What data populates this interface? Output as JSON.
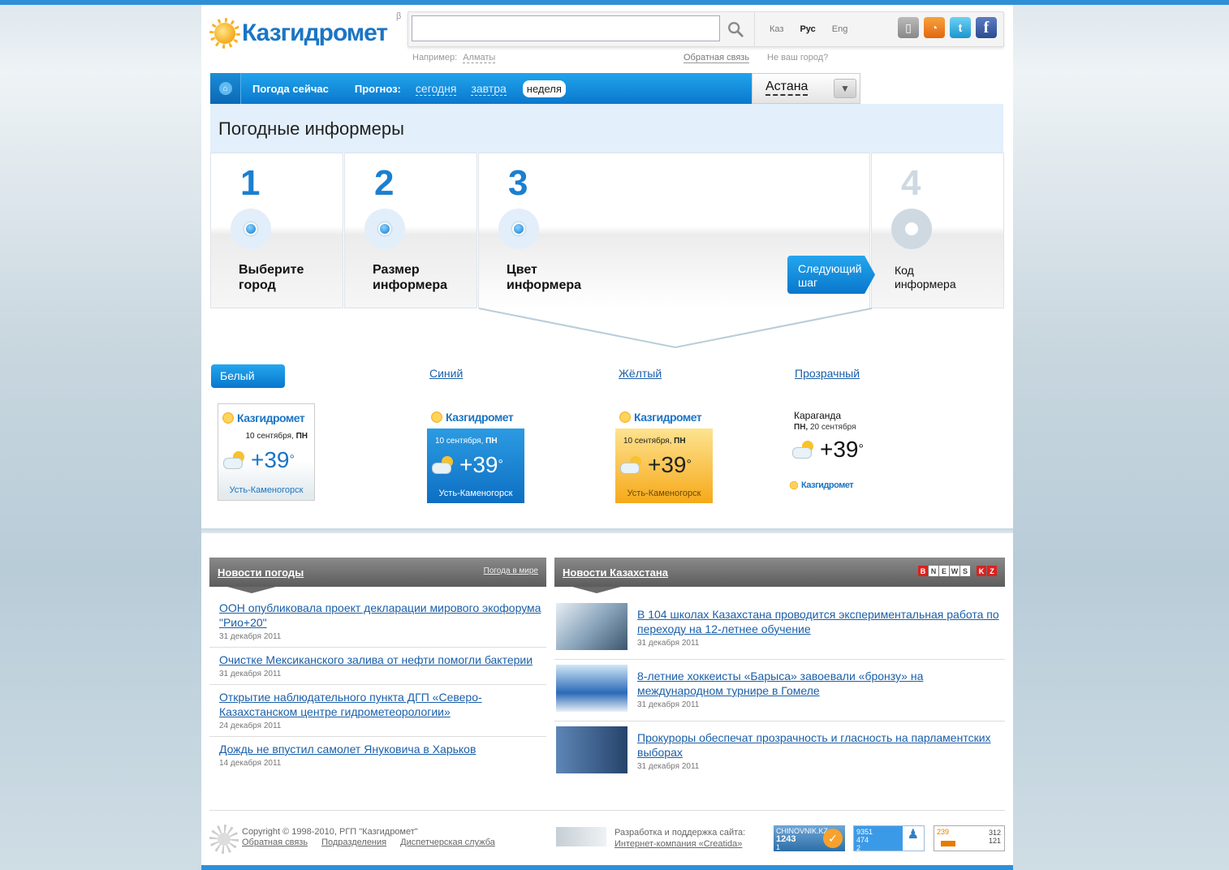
{
  "logo": {
    "text": "Казгидромет",
    "beta": "β"
  },
  "search": {
    "value": "",
    "placeholder": "",
    "example_prefix": "Например:",
    "example_city": "Алматы",
    "feedback": "Обратная связь",
    "not_your_city": "Не ваш город?"
  },
  "languages": [
    {
      "label": "Каз",
      "active": false
    },
    {
      "label": "Рус",
      "active": true
    },
    {
      "label": "Eng",
      "active": false
    }
  ],
  "socials": [
    "mobile-icon",
    "rss-icon",
    "twitter-icon",
    "facebook-icon"
  ],
  "nav": {
    "now": "Погода сейчас",
    "forecast": "Прогноз:",
    "today": "сегодня",
    "tomorrow": "завтра",
    "week": "неделя",
    "city": "Астана"
  },
  "page_title": "Погодные информеры",
  "steps": [
    {
      "num": "1",
      "label": "Выберите\nгород"
    },
    {
      "num": "2",
      "label": "Размер\nинформера"
    },
    {
      "num": "3",
      "label": "Цвет\nинформера"
    },
    {
      "num": "4",
      "label": "Код\nинформера"
    }
  ],
  "next_button": "Следующий\nшаг",
  "colors": {
    "white": "Белый",
    "blue": "Синий",
    "yellow": "Жёлтый",
    "transparent": "Прозрачный"
  },
  "informer": {
    "logo": "Казгидромет",
    "date": "10 сентября,",
    "weekday": "ПН",
    "temp": "+39",
    "deg": "°",
    "city": "Усть-Каменогорск",
    "t_city": "Караганда",
    "t_weekday": "ПН,",
    "t_date": "20 сентября"
  },
  "news_weather": {
    "title": "Новости погоды",
    "link": "Погода в мире",
    "items": [
      {
        "title": "ООН опубликовала проект декларации мирового экофорума \"Рио+20\"",
        "date": "31 декабря 2011"
      },
      {
        "title": "Очистке Мексиканского залива от нефти помогли бактерии",
        "date": "31 декабря 2011"
      },
      {
        "title": "Открытие наблюдательного пункта ДГП «Северо-Казахстанском центре гидрометеорологии»",
        "date": "24 декабря 2011"
      },
      {
        "title": "Дождь не впустил самолет Януковича в Харьков",
        "date": "14 декабря 2011"
      }
    ]
  },
  "news_kz": {
    "title": "Новости Казахстана",
    "badge": [
      "B",
      "N",
      "E",
      "W",
      "S",
      "K",
      "Z"
    ],
    "items": [
      {
        "title": "В 104 школах Казахстана проводится экспериментальная работа по переходу на 12-летнее обучение",
        "date": "31 декабря 2011"
      },
      {
        "title": "8-летние хоккеисты «Барыса» завоевали «бронзу» на международном турнире в Гомеле",
        "date": "31 декабря 2011"
      },
      {
        "title": "Прокуроры обеспечат прозрачность и гласность на парламентских выборах",
        "date": "31 декабря 2011"
      }
    ]
  },
  "footer": {
    "copyright": "Copyright © 1998-2010, РГП \"Казгидромет\"",
    "links": [
      "Обратная связь",
      "Подразделения",
      "Диспетчерская служба"
    ],
    "dev_label": "Разработка и поддержка сайта:",
    "dev_link": "Интернет-компания «Creatida»",
    "counter1": {
      "name": "CHINOVNIK.KZ",
      "value": "1243",
      "sub": "1"
    },
    "counter2": {
      "a": "9351",
      "b": "474",
      "c": "2"
    },
    "counter3": {
      "a": "239",
      "b": "312",
      "c": "121"
    }
  }
}
